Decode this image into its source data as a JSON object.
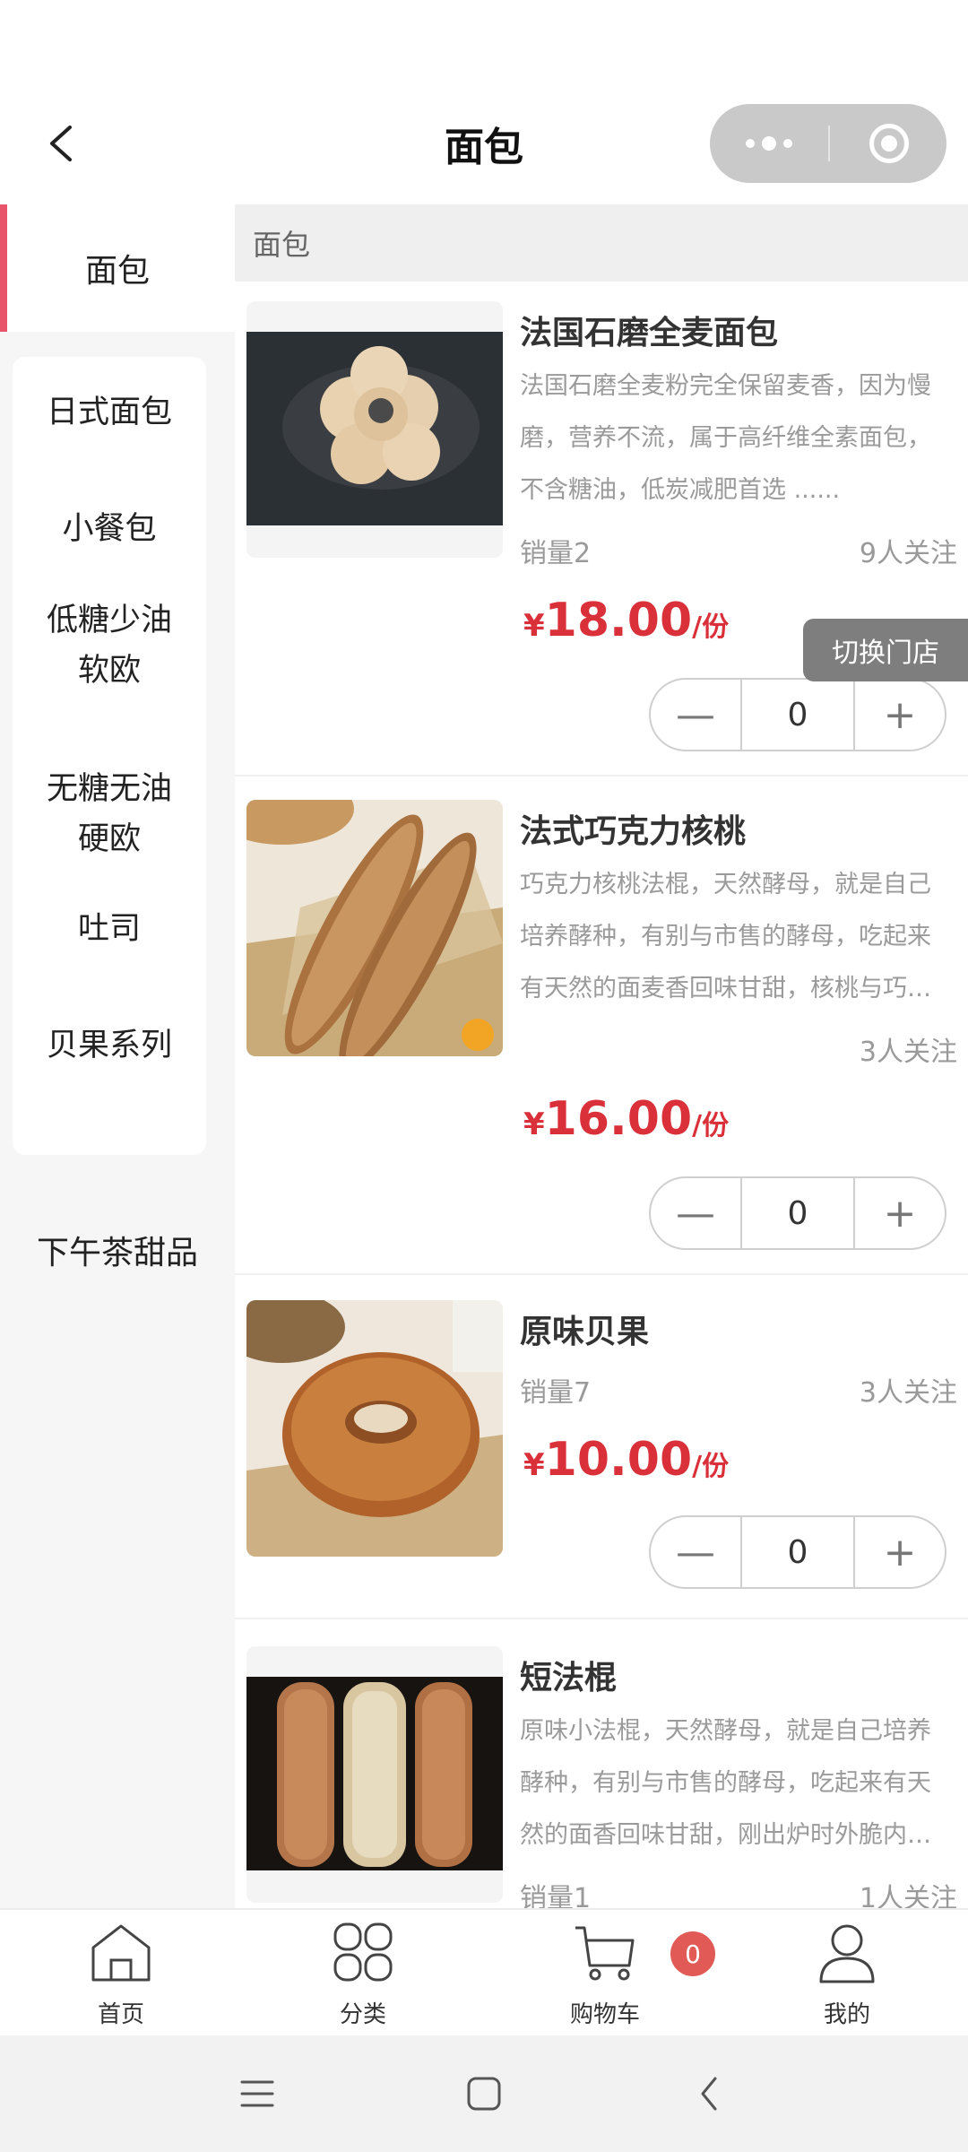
{
  "header": {
    "title": "面包"
  },
  "sidebar": {
    "active": "面包",
    "subcategories": [
      "日式面包",
      "小餐包",
      "低糖少油软欧",
      "无糖无油硬欧",
      "吐司",
      "贝果系列"
    ],
    "other": "下午茶甜品"
  },
  "section": {
    "title": "面包"
  },
  "products": [
    {
      "name": "法国石磨全麦面包",
      "desc_lines": [
        "法国石磨全麦粉完全保留麦香，因为慢",
        "磨，营养不流，属于高纤维全素面包，",
        "不含糖油，低炭减肥首选 ......"
      ],
      "sales": "销量2",
      "followers": "9人关注",
      "currency": "¥",
      "price": "18.00",
      "unit": "/份",
      "qty": "0"
    },
    {
      "name": "法式巧克力核桃",
      "desc_lines": [
        "巧克力核桃法棍，天然酵母，就是自己",
        "培养酵种，有别与市售的酵母，吃起来",
        "有天然的面麦香回味甘甜，核桃与巧…"
      ],
      "sales": "",
      "followers": "3人关注",
      "currency": "¥",
      "price": "16.00",
      "unit": "/份",
      "qty": "0"
    },
    {
      "name": "原味贝果",
      "desc_lines": [],
      "sales": "销量7",
      "followers": "3人关注",
      "currency": "¥",
      "price": "10.00",
      "unit": "/份",
      "qty": "0"
    },
    {
      "name": "短法棍",
      "desc_lines": [
        "原味小法棍，天然酵母，就是自己培养",
        "酵种，有别与市售的酵母，吃起来有天",
        "然的面香回味甘甜，刚出炉时外脆内…"
      ],
      "sales": "销量1",
      "followers": "1人关注"
    }
  ],
  "switch_store": "切换门店",
  "tabbar": {
    "items": [
      {
        "label": "首页",
        "icon": "home-icon"
      },
      {
        "label": "分类",
        "icon": "category-icon"
      },
      {
        "label": "购物车",
        "icon": "cart-icon"
      },
      {
        "label": "我的",
        "icon": "user-icon"
      }
    ],
    "cart_badge": "0"
  },
  "colors": {
    "accent": "#e8556a",
    "price": "#d9303a",
    "badge": "#e25a55"
  }
}
